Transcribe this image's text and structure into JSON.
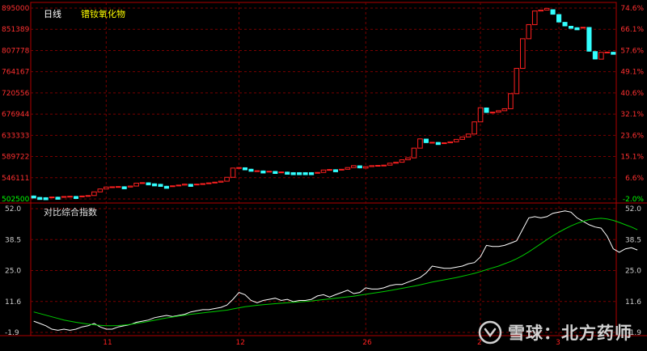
{
  "header": {
    "period_label": "日线",
    "product_name": "镨钕氧化物"
  },
  "sub_chart": {
    "title": "对比综合指数"
  },
  "watermark": {
    "text": "雪球：北方药师"
  },
  "colors": {
    "background": "#000000",
    "grid": "#7a0000",
    "frame": "#b00000",
    "up_candle": "#ff2020",
    "down_candle": "#33ffff",
    "price_label_up": "#ff3030",
    "price_label_base": "#00ff00",
    "header_period": "#ffffff",
    "header_name": "#ffff00",
    "index_line": "#ffffff",
    "ma_line": "#00cc00",
    "axis_text_sub": "#cccccc",
    "date_label": "#ff2020"
  },
  "chart_data": [
    {
      "type": "candlestick",
      "title": "镨钕氧化物",
      "period": "日线",
      "y_left_ticks": [
        "895000",
        "851389",
        "807778",
        "764167",
        "720556",
        "676944",
        "633333",
        "589722",
        "546111",
        "502500"
      ],
      "y_right_ticks": [
        "74.6%",
        "66.1%",
        "57.6%",
        "49.1%",
        "40.6%",
        "32.1%",
        "23.6%",
        "15.1%",
        "6.6%",
        "-2.0%"
      ],
      "ylim": [
        502500,
        895000
      ],
      "x_tick_labels": [
        {
          "label": "11",
          "index": 12
        },
        {
          "label": "12",
          "index": 34
        },
        {
          "label": "26",
          "index": 55
        },
        {
          "label": "2",
          "index": 74
        },
        {
          "label": "3",
          "index": 87
        }
      ],
      "candles": [
        {
          "open": 509000,
          "close": 505500,
          "high": 509500,
          "low": 504500,
          "dir": "down"
        },
        {
          "open": 506000,
          "close": 505000,
          "high": 506500,
          "low": 504500,
          "dir": "down"
        },
        {
          "open": 505500,
          "close": 505000,
          "high": 506000,
          "low": 504500,
          "dir": "down"
        },
        {
          "open": 505000,
          "close": 506500,
          "high": 507000,
          "low": 504500,
          "dir": "up"
        },
        {
          "open": 506500,
          "close": 506000,
          "high": 507000,
          "low": 505500,
          "dir": "down"
        },
        {
          "open": 506000,
          "close": 507500,
          "high": 508000,
          "low": 505500,
          "dir": "up"
        },
        {
          "open": 507500,
          "close": 508000,
          "high": 508500,
          "low": 507000,
          "dir": "up"
        },
        {
          "open": 508000,
          "close": 507000,
          "high": 508500,
          "low": 506500,
          "dir": "down"
        },
        {
          "open": 507000,
          "close": 508500,
          "high": 509000,
          "low": 506500,
          "dir": "up"
        },
        {
          "open": 508500,
          "close": 509500,
          "high": 510000,
          "low": 508000,
          "dir": "up"
        },
        {
          "open": 509500,
          "close": 517000,
          "high": 517500,
          "low": 509000,
          "dir": "up"
        },
        {
          "open": 517000,
          "close": 523000,
          "high": 523500,
          "low": 516500,
          "dir": "up"
        },
        {
          "open": 523000,
          "close": 527000,
          "high": 528000,
          "low": 522500,
          "dir": "up"
        },
        {
          "open": 527000,
          "close": 527500,
          "high": 528000,
          "low": 526500,
          "dir": "up"
        },
        {
          "open": 527500,
          "close": 528000,
          "high": 528500,
          "low": 527000,
          "dir": "up"
        },
        {
          "open": 528000,
          "close": 527000,
          "high": 528500,
          "low": 526500,
          "dir": "down"
        },
        {
          "open": 527000,
          "close": 529000,
          "high": 529500,
          "low": 526500,
          "dir": "up"
        },
        {
          "open": 529000,
          "close": 535000,
          "high": 535500,
          "low": 528500,
          "dir": "up"
        },
        {
          "open": 535000,
          "close": 536000,
          "high": 536500,
          "low": 534500,
          "dir": "up"
        },
        {
          "open": 536000,
          "close": 534000,
          "high": 536500,
          "low": 533500,
          "dir": "down"
        },
        {
          "open": 534000,
          "close": 533000,
          "high": 534500,
          "low": 532500,
          "dir": "down"
        },
        {
          "open": 533000,
          "close": 529000,
          "high": 533500,
          "low": 528500,
          "dir": "down"
        },
        {
          "open": 529000,
          "close": 528500,
          "high": 529500,
          "low": 528000,
          "dir": "down"
        },
        {
          "open": 528500,
          "close": 529500,
          "high": 530000,
          "low": 528000,
          "dir": "up"
        },
        {
          "open": 529500,
          "close": 531000,
          "high": 531500,
          "low": 529000,
          "dir": "up"
        },
        {
          "open": 531000,
          "close": 533000,
          "high": 533500,
          "low": 530500,
          "dir": "up"
        },
        {
          "open": 533000,
          "close": 532000,
          "high": 533500,
          "low": 531500,
          "dir": "down"
        },
        {
          "open": 532000,
          "close": 533000,
          "high": 533500,
          "low": 531500,
          "dir": "up"
        },
        {
          "open": 533000,
          "close": 534000,
          "high": 534500,
          "low": 532500,
          "dir": "up"
        },
        {
          "open": 534000,
          "close": 535500,
          "high": 536000,
          "low": 533500,
          "dir": "up"
        },
        {
          "open": 535500,
          "close": 537000,
          "high": 537500,
          "low": 535000,
          "dir": "up"
        },
        {
          "open": 537000,
          "close": 539000,
          "high": 539500,
          "low": 536500,
          "dir": "up"
        },
        {
          "open": 539000,
          "close": 547000,
          "high": 547500,
          "low": 538500,
          "dir": "up"
        },
        {
          "open": 547000,
          "close": 566000,
          "high": 566500,
          "low": 546500,
          "dir": "up"
        },
        {
          "open": 566000,
          "close": 567000,
          "high": 567500,
          "low": 565500,
          "dir": "up"
        },
        {
          "open": 567000,
          "close": 564000,
          "high": 567500,
          "low": 563500,
          "dir": "down"
        },
        {
          "open": 564000,
          "close": 560000,
          "high": 564500,
          "low": 559500,
          "dir": "down"
        },
        {
          "open": 560000,
          "close": 560500,
          "high": 561000,
          "low": 559500,
          "dir": "up"
        },
        {
          "open": 560500,
          "close": 559000,
          "high": 561000,
          "low": 558500,
          "dir": "down"
        },
        {
          "open": 559000,
          "close": 559500,
          "high": 560000,
          "low": 558500,
          "dir": "up"
        },
        {
          "open": 559500,
          "close": 557500,
          "high": 560000,
          "low": 557000,
          "dir": "down"
        },
        {
          "open": 557500,
          "close": 558000,
          "high": 558500,
          "low": 557000,
          "dir": "up"
        },
        {
          "open": 558000,
          "close": 557000,
          "high": 558500,
          "low": 556500,
          "dir": "down"
        },
        {
          "open": 557000,
          "close": 557000,
          "high": 557500,
          "low": 556500,
          "dir": "down"
        },
        {
          "open": 557000,
          "close": 557000,
          "high": 557500,
          "low": 556500,
          "dir": "down"
        },
        {
          "open": 557000,
          "close": 557000,
          "high": 557500,
          "low": 556500,
          "dir": "down"
        },
        {
          "open": 557000,
          "close": 556500,
          "high": 557500,
          "low": 556000,
          "dir": "down"
        },
        {
          "open": 556500,
          "close": 557000,
          "high": 557500,
          "low": 556000,
          "dir": "up"
        },
        {
          "open": 557000,
          "close": 562000,
          "high": 562500,
          "low": 556500,
          "dir": "up"
        },
        {
          "open": 562000,
          "close": 563000,
          "high": 563500,
          "low": 561500,
          "dir": "up"
        },
        {
          "open": 563000,
          "close": 562000,
          "high": 563500,
          "low": 561500,
          "dir": "down"
        },
        {
          "open": 562000,
          "close": 563500,
          "high": 564000,
          "low": 561500,
          "dir": "up"
        },
        {
          "open": 563500,
          "close": 567000,
          "high": 567500,
          "low": 563000,
          "dir": "up"
        },
        {
          "open": 567000,
          "close": 571000,
          "high": 571500,
          "low": 566500,
          "dir": "up"
        },
        {
          "open": 571000,
          "close": 566000,
          "high": 571500,
          "low": 565500,
          "dir": "down"
        },
        {
          "open": 566000,
          "close": 569000,
          "high": 569500,
          "low": 565500,
          "dir": "up"
        },
        {
          "open": 569000,
          "close": 571000,
          "high": 571500,
          "low": 568500,
          "dir": "up"
        },
        {
          "open": 571000,
          "close": 571500,
          "high": 572000,
          "low": 570500,
          "dir": "up"
        },
        {
          "open": 571500,
          "close": 572000,
          "high": 572500,
          "low": 571000,
          "dir": "up"
        },
        {
          "open": 572000,
          "close": 576000,
          "high": 576500,
          "low": 571500,
          "dir": "up"
        },
        {
          "open": 576000,
          "close": 578000,
          "high": 578500,
          "low": 575500,
          "dir": "up"
        },
        {
          "open": 578000,
          "close": 583000,
          "high": 583500,
          "low": 577500,
          "dir": "up"
        },
        {
          "open": 583000,
          "close": 587000,
          "high": 587500,
          "low": 582500,
          "dir": "up"
        },
        {
          "open": 587000,
          "close": 607000,
          "high": 607500,
          "low": 586500,
          "dir": "up"
        },
        {
          "open": 607000,
          "close": 626000,
          "high": 626500,
          "low": 606500,
          "dir": "up"
        },
        {
          "open": 626000,
          "close": 618000,
          "high": 626500,
          "low": 617500,
          "dir": "down"
        },
        {
          "open": 618000,
          "close": 619000,
          "high": 619500,
          "low": 617500,
          "dir": "up"
        },
        {
          "open": 619000,
          "close": 617000,
          "high": 619500,
          "low": 616500,
          "dir": "down"
        },
        {
          "open": 617000,
          "close": 618000,
          "high": 618500,
          "low": 616500,
          "dir": "up"
        },
        {
          "open": 618000,
          "close": 620000,
          "high": 620500,
          "low": 617500,
          "dir": "up"
        },
        {
          "open": 620000,
          "close": 625000,
          "high": 625500,
          "low": 619500,
          "dir": "up"
        },
        {
          "open": 625000,
          "close": 630000,
          "high": 630500,
          "low": 624500,
          "dir": "up"
        },
        {
          "open": 630000,
          "close": 636000,
          "high": 636500,
          "low": 629500,
          "dir": "up"
        },
        {
          "open": 636000,
          "close": 661000,
          "high": 661500,
          "low": 635500,
          "dir": "up"
        },
        {
          "open": 661000,
          "close": 690000,
          "high": 690500,
          "low": 660500,
          "dir": "up"
        },
        {
          "open": 690000,
          "close": 680000,
          "high": 690500,
          "low": 679500,
          "dir": "down"
        },
        {
          "open": 680000,
          "close": 681000,
          "high": 681500,
          "low": 679500,
          "dir": "up"
        },
        {
          "open": 681000,
          "close": 684000,
          "high": 684500,
          "low": 680500,
          "dir": "up"
        },
        {
          "open": 684000,
          "close": 688000,
          "high": 688500,
          "low": 683500,
          "dir": "up"
        },
        {
          "open": 688000,
          "close": 719000,
          "high": 719500,
          "low": 687500,
          "dir": "up"
        },
        {
          "open": 719000,
          "close": 771000,
          "high": 771500,
          "low": 718500,
          "dir": "up"
        },
        {
          "open": 771000,
          "close": 832000,
          "high": 832500,
          "low": 770500,
          "dir": "up"
        },
        {
          "open": 832000,
          "close": 861000,
          "high": 861500,
          "low": 831500,
          "dir": "up"
        },
        {
          "open": 861000,
          "close": 889000,
          "high": 889500,
          "low": 860500,
          "dir": "up"
        },
        {
          "open": 889000,
          "close": 891000,
          "high": 891500,
          "low": 888500,
          "dir": "up"
        },
        {
          "open": 891000,
          "close": 894500,
          "high": 895000,
          "low": 890500,
          "dir": "up"
        },
        {
          "open": 892000,
          "close": 882000,
          "high": 892500,
          "low": 881500,
          "dir": "down"
        },
        {
          "open": 882000,
          "close": 866000,
          "high": 882500,
          "low": 865500,
          "dir": "down"
        },
        {
          "open": 866000,
          "close": 858000,
          "high": 866500,
          "low": 857500,
          "dir": "down"
        },
        {
          "open": 858000,
          "close": 855000,
          "high": 858500,
          "low": 854500,
          "dir": "down"
        },
        {
          "open": 855000,
          "close": 854000,
          "high": 855500,
          "low": 853500,
          "dir": "down"
        },
        {
          "open": 854000,
          "close": 855500,
          "high": 856000,
          "low": 853500,
          "dir": "up"
        },
        {
          "open": 855500,
          "close": 806000,
          "high": 856000,
          "low": 805500,
          "dir": "down"
        },
        {
          "open": 806000,
          "close": 790000,
          "high": 806500,
          "low": 789500,
          "dir": "down"
        },
        {
          "open": 790000,
          "close": 804000,
          "high": 804500,
          "low": 789500,
          "dir": "up"
        },
        {
          "open": 804000,
          "close": 804500,
          "high": 805000,
          "low": 803500,
          "dir": "up"
        },
        {
          "open": 804500,
          "close": 802000,
          "high": 805000,
          "low": 801500,
          "dir": "down"
        }
      ]
    },
    {
      "type": "line",
      "title": "对比综合指数",
      "y_ticks": [
        "52.0",
        "38.5",
        "25.0",
        "11.6",
        "-1.9"
      ],
      "ylim": [
        -1.9,
        52.0
      ],
      "series": [
        {
          "color": "#ffffff",
          "values": [
            3.0,
            2.0,
            1.0,
            -0.5,
            -1.0,
            -0.5,
            -1.0,
            -0.5,
            0.5,
            1.0,
            2.0,
            0.5,
            -0.5,
            -0.5,
            0.5,
            1.0,
            1.5,
            2.5,
            3.0,
            3.5,
            4.5,
            5.0,
            5.5,
            5.0,
            5.5,
            6.0,
            7.0,
            7.5,
            8.0,
            8.0,
            8.5,
            9.0,
            10.0,
            12.5,
            15.5,
            14.5,
            12.0,
            11.0,
            12.0,
            12.5,
            13.0,
            12.0,
            12.5,
            11.5,
            12.0,
            12.0,
            12.5,
            14.0,
            14.5,
            13.5,
            14.5,
            15.5,
            16.5,
            15.0,
            15.5,
            17.5,
            17.0,
            17.0,
            17.5,
            18.5,
            19.0,
            19.0,
            20.0,
            21.0,
            22.0,
            24.0,
            27.0,
            26.5,
            26.0,
            26.0,
            26.5,
            27.0,
            28.0,
            28.5,
            31.0,
            36.0,
            35.5,
            35.5,
            36.0,
            37.0,
            38.0,
            43.0,
            48.0,
            48.5,
            48.0,
            48.5,
            50.0,
            50.5,
            51.0,
            50.5,
            48.0,
            46.5,
            45.0,
            44.0,
            43.5,
            40.0,
            34.5,
            33.0,
            34.5,
            35.0,
            34.0
          ]
        },
        {
          "color": "#00cc00",
          "values": [
            7.0,
            6.3,
            5.6,
            4.9,
            4.2,
            3.5,
            3.0,
            2.5,
            2.1,
            1.7,
            1.4,
            1.2,
            1.0,
            1.0,
            1.1,
            1.3,
            1.6,
            2.0,
            2.4,
            2.9,
            3.4,
            3.9,
            4.4,
            4.8,
            5.2,
            5.6,
            6.0,
            6.3,
            6.6,
            6.9,
            7.2,
            7.5,
            7.8,
            8.3,
            8.8,
            9.3,
            9.6,
            9.9,
            10.2,
            10.4,
            10.6,
            10.8,
            11.0,
            11.2,
            11.4,
            11.6,
            11.8,
            12.1,
            12.4,
            12.7,
            13.0,
            13.3,
            13.6,
            13.9,
            14.3,
            14.7,
            15.1,
            15.5,
            15.9,
            16.3,
            16.8,
            17.3,
            17.8,
            18.3,
            18.8,
            19.4,
            20.0,
            20.5,
            21.0,
            21.5,
            22.0,
            22.6,
            23.2,
            23.8,
            24.6,
            25.4,
            26.2,
            27.0,
            28.0,
            29.0,
            30.2,
            31.6,
            33.2,
            34.9,
            36.7,
            38.5,
            40.2,
            41.8,
            43.2,
            44.5,
            45.6,
            46.5,
            47.2,
            47.6,
            47.8,
            47.5,
            46.9,
            46.0,
            45.0,
            44.0,
            42.8
          ]
        }
      ]
    }
  ]
}
